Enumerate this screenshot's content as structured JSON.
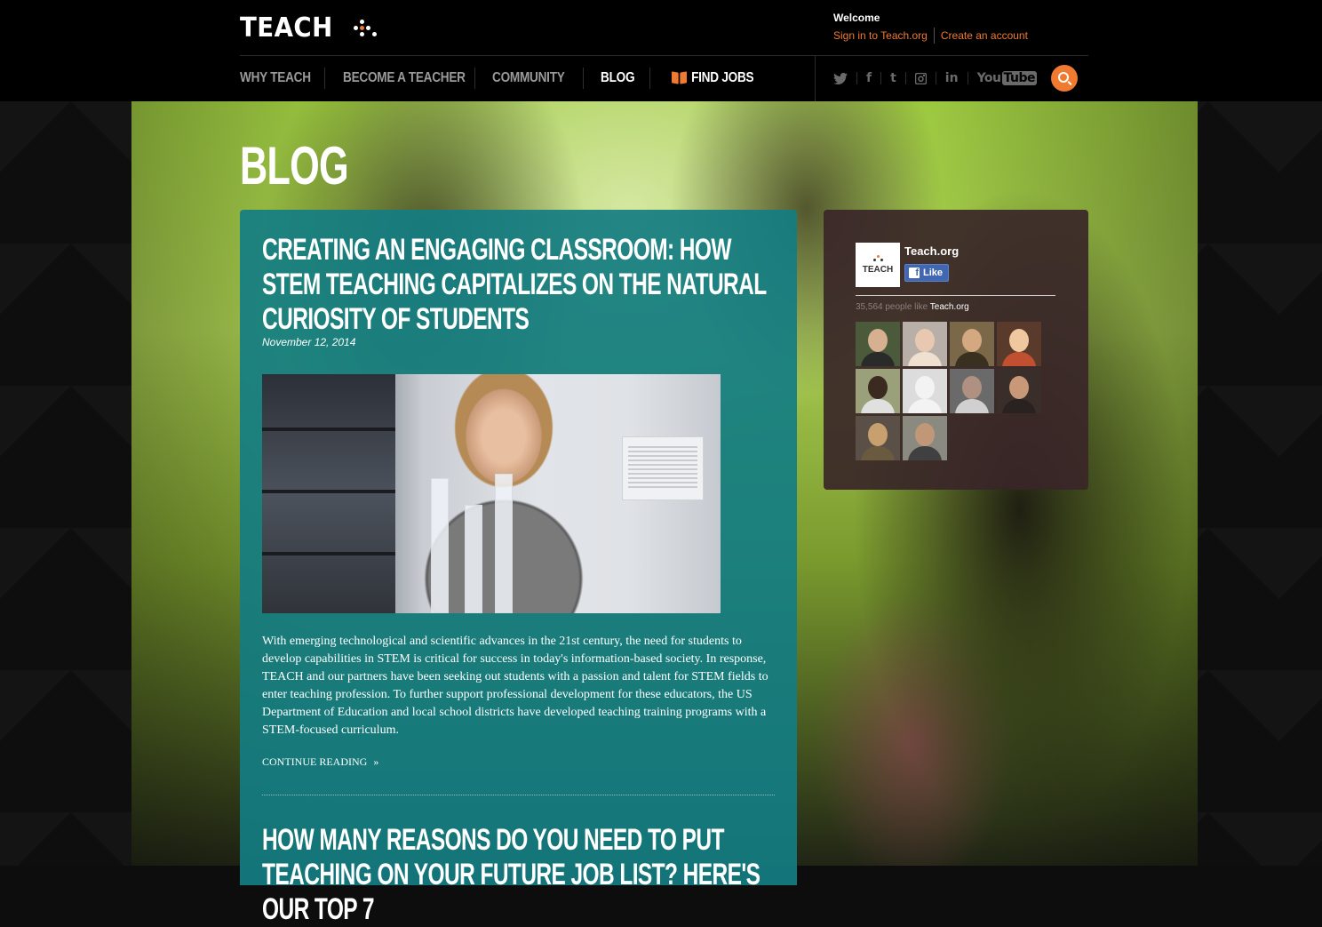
{
  "brand": {
    "logo_text": "TEACH"
  },
  "account": {
    "welcome": "Welcome",
    "sign_in": "Sign in to Teach.org",
    "create_account": "Create an account"
  },
  "nav": {
    "items": [
      "WHY TEACH",
      "BECOME A TEACHER",
      "COMMUNITY",
      "BLOG"
    ],
    "find_jobs": "FIND JOBS",
    "active": "BLOG"
  },
  "social": {
    "icons": [
      "twitter-icon",
      "facebook-icon",
      "tumblr-icon",
      "instagram-icon",
      "linkedin-icon",
      "youtube-icon"
    ],
    "glyphs": {
      "twitter": "🐦",
      "facebook": "f",
      "tumblr": "t",
      "instagram": "▣",
      "linkedin": "in",
      "youtube_a": "You",
      "youtube_b": "Tube"
    }
  },
  "page": {
    "title": "BLOG"
  },
  "posts": [
    {
      "title": "CREATING AN ENGAGING CLASSROOM: HOW STEM TEACHING CAPITALIZES ON THE NATURAL CURIOSITY OF STUDENTS",
      "date": "November 12, 2014",
      "excerpt": "With emerging technological and scientific advances in the 21st century, the need for students to develop capabilities in STEM is critical for success in today's information-based society. In response, TEACH and our partners have been seeking out students with a passion and talent for STEM fields to enter teaching profession. To further support professional development for these educators, the US Department of Education and local school districts have developed teaching training programs with a STEM-focused curriculum.",
      "continue_label": "CONTINUE READING",
      "continue_arrow": "»"
    },
    {
      "title": "HOW MANY REASONS DO YOU NEED TO PUT TEACHING ON YOUR FUTURE JOB LIST? HERE'S OUR TOP 7"
    }
  ],
  "facebook": {
    "page_name": "Teach.org",
    "avatar_text": "TEACH",
    "like_label": "Like",
    "fans_count": "35,564 people like",
    "fans_page": "Teach.org"
  },
  "colors": {
    "accent": "#f07a2f",
    "panel_teal": "#147d82",
    "panel_fb": "#3a2628",
    "header_bg": "#000000"
  }
}
